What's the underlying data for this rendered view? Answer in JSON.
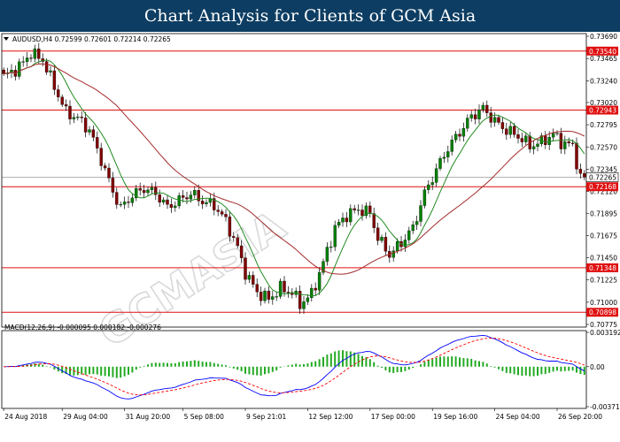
{
  "banner": {
    "title": "Chart Analysis for Clients of GCM Asia"
  },
  "chart_data": {
    "type": "candlestick",
    "symbol_header": "AUDUSD,H4  0.72599 0.72601 0.72214 0.72265",
    "price_axis": {
      "ylim": [
        0.70775,
        0.7369
      ],
      "ticks": [
        "0.73690",
        "0.73465",
        "0.73240",
        "0.73020",
        "0.72795",
        "0.72570",
        "0.72345",
        "0.72120",
        "0.71895",
        "0.71675",
        "0.71450",
        "0.71225",
        "0.71000",
        "0.70775"
      ]
    },
    "time_axis": {
      "labels": [
        "24 Aug 2018",
        "29 Aug 04:00",
        "31 Aug 20:00",
        "5 Sep 08:00",
        "9 Sep 21:01",
        "12 Sep 12:00",
        "17 Sep 00:00",
        "19 Sep 16:00",
        "24 Sep 04:00",
        "26 Sep 20:00"
      ],
      "label_bars": [
        0,
        15,
        31,
        46,
        62,
        78,
        94,
        110,
        126,
        142
      ]
    },
    "levels": [
      {
        "value": 0.7354,
        "label": "0.73540"
      },
      {
        "value": 0.72943,
        "label": "0.72943"
      },
      {
        "value": 0.72168,
        "label": "0.72168"
      },
      {
        "value": 0.71348,
        "label": "0.71348"
      },
      {
        "value": 0.70898,
        "label": "0.70898"
      }
    ],
    "current_price": {
      "value": 0.72265,
      "label": "0.72265"
    },
    "price_path": [
      [
        0,
        0.7328
      ],
      [
        4,
        0.7338
      ],
      [
        7,
        0.7352
      ],
      [
        10,
        0.7345
      ],
      [
        13,
        0.7318
      ],
      [
        16,
        0.7292
      ],
      [
        19,
        0.7286
      ],
      [
        22,
        0.7274
      ],
      [
        25,
        0.7244
      ],
      [
        28,
        0.7212
      ],
      [
        30,
        0.7195
      ],
      [
        33,
        0.7208
      ],
      [
        36,
        0.7215
      ],
      [
        39,
        0.721
      ],
      [
        42,
        0.7196
      ],
      [
        45,
        0.7203
      ],
      [
        48,
        0.721
      ],
      [
        51,
        0.7202
      ],
      [
        54,
        0.7198
      ],
      [
        57,
        0.7182
      ],
      [
        60,
        0.7155
      ],
      [
        62,
        0.713
      ],
      [
        65,
        0.711
      ],
      [
        68,
        0.7103
      ],
      [
        71,
        0.7114
      ],
      [
        74,
        0.711
      ],
      [
        76,
        0.7098
      ],
      [
        79,
        0.7108
      ],
      [
        82,
        0.714
      ],
      [
        85,
        0.7175
      ],
      [
        88,
        0.7188
      ],
      [
        91,
        0.7194
      ],
      [
        94,
        0.719
      ],
      [
        96,
        0.7165
      ],
      [
        99,
        0.7148
      ],
      [
        102,
        0.716
      ],
      [
        105,
        0.7175
      ],
      [
        108,
        0.721
      ],
      [
        111,
        0.7234
      ],
      [
        114,
        0.7256
      ],
      [
        117,
        0.7272
      ],
      [
        120,
        0.7288
      ],
      [
        123,
        0.7296
      ],
      [
        126,
        0.7283
      ],
      [
        129,
        0.7274
      ],
      [
        132,
        0.7268
      ],
      [
        135,
        0.7258
      ],
      [
        138,
        0.7262
      ],
      [
        141,
        0.727
      ],
      [
        143,
        0.7262
      ],
      [
        146,
        0.7258
      ],
      [
        148,
        0.7226
      ]
    ],
    "price_data_note": "Approximate close prices by bar index (0 = first bar).",
    "ma_series": [
      {
        "color": "#228b22",
        "period": 8
      },
      {
        "color": "#a52a2a",
        "period": 30
      }
    ],
    "candle_colors": {
      "bull": "#008000",
      "bear": "#800000"
    },
    "macd": {
      "label": "MACD(12,26,9) -0.000095 0.000182 -0.000276",
      "ylim": [
        -0.003718,
        0.003192
      ],
      "ticks": [
        "0.003192",
        "0.00",
        "-0.003718"
      ],
      "colors": {
        "histogram": "#22aa22",
        "macd": "#0000ff",
        "signal": "#ff0000"
      }
    },
    "watermark": "GCMASIA"
  }
}
